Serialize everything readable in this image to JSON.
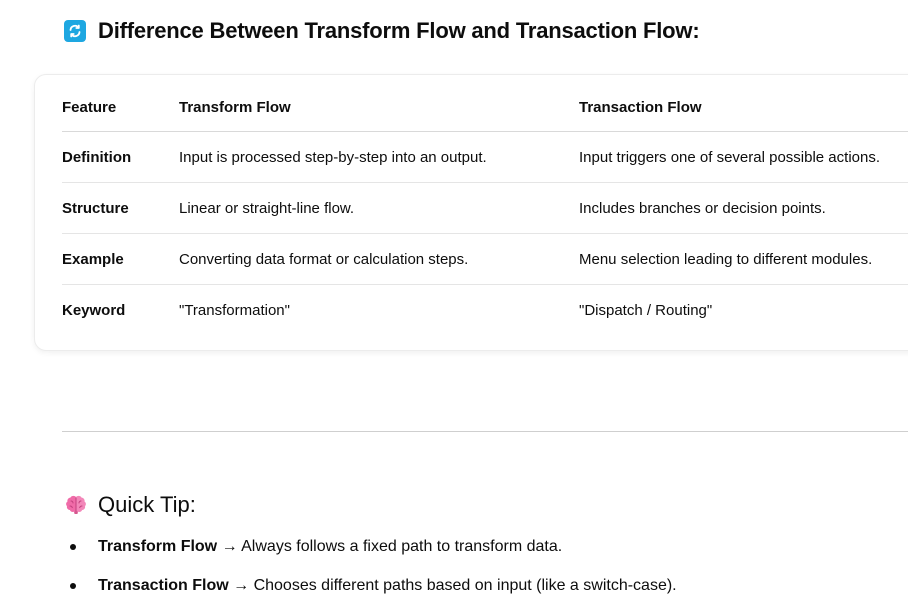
{
  "heading": {
    "emoji": "🔄",
    "text": "Difference Between Transform Flow and Transaction Flow:"
  },
  "table": {
    "headers": [
      "Feature",
      "Transform Flow",
      "Transaction Flow"
    ],
    "rows": [
      [
        "Definition",
        "Input is processed step-by-step into an output.",
        "Input triggers one of several possible actions."
      ],
      [
        "Structure",
        "Linear or straight-line flow.",
        "Includes branches or decision points."
      ],
      [
        "Example",
        "Converting data format or calculation steps.",
        "Menu selection leading to different modules."
      ],
      [
        "Keyword",
        "\"Transformation\"",
        "\"Dispatch / Routing\""
      ]
    ]
  },
  "tip": {
    "emoji": "🧠",
    "title": "Quick Tip:",
    "items": [
      {
        "bold": "Transform Flow",
        "rest": " → Always follows a fixed path to transform data."
      },
      {
        "bold": "Transaction Flow",
        "rest": " → Chooses different paths based on input (like a switch-case)."
      }
    ]
  },
  "colors": {
    "icon_blue": "#1ea7e1",
    "brain_pink": "#f06ba8",
    "divider": "#cfcfcf"
  }
}
